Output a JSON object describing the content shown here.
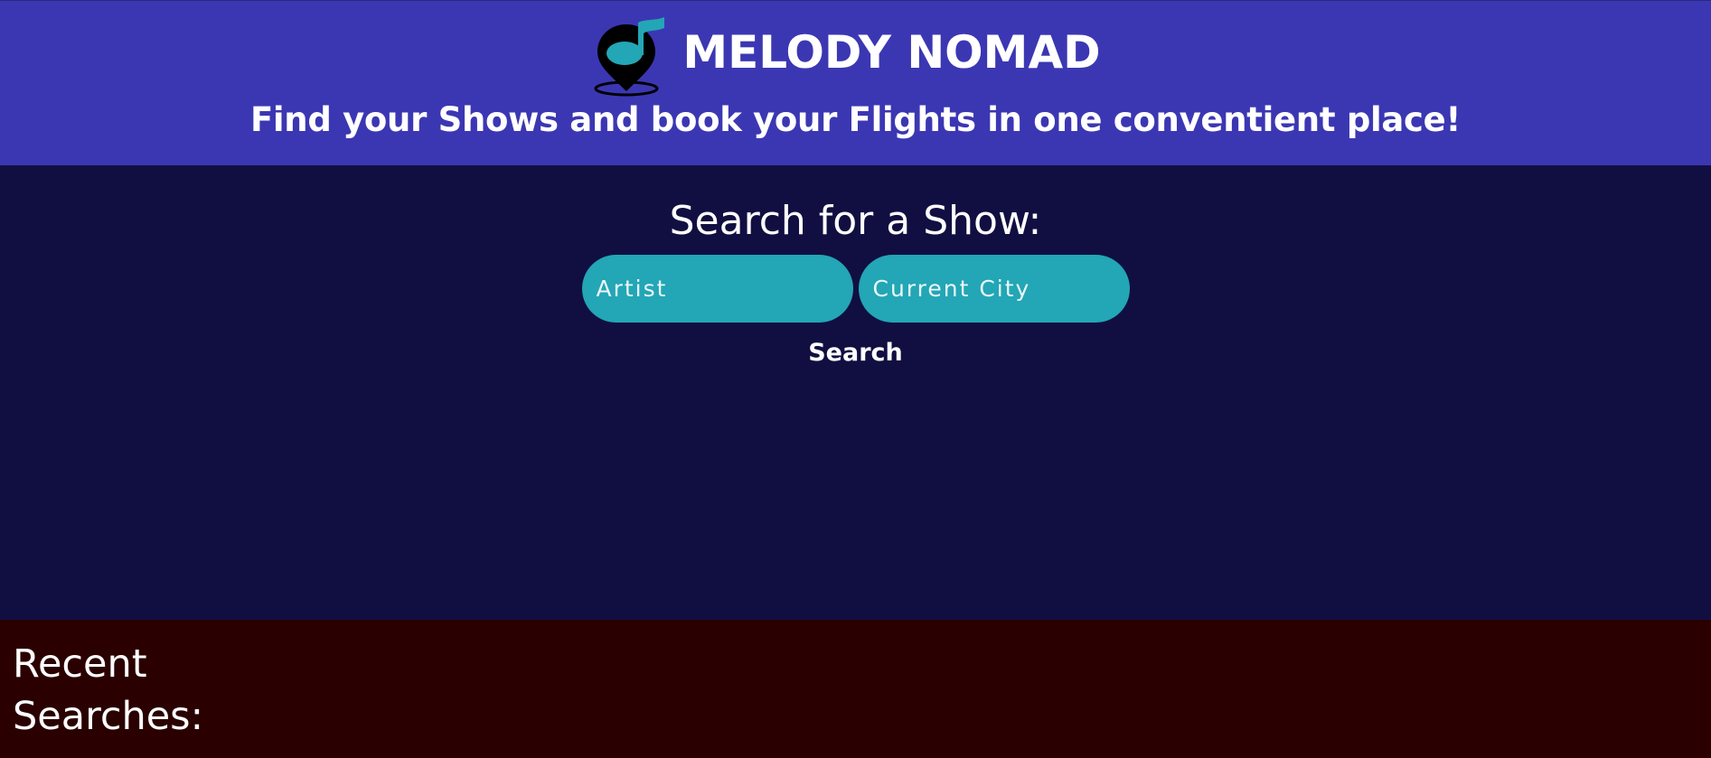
{
  "header": {
    "title": "MELODY NOMAD",
    "tagline": "Find your Shows and book your Flights in one conventient place!",
    "logo_icon": "music-note-map-pin-icon"
  },
  "search": {
    "heading": "Search for a Show:",
    "artist_placeholder": "Artist",
    "city_placeholder": "Current City",
    "button_label": "Search"
  },
  "recent": {
    "heading": "Recent Searches:"
  },
  "colors": {
    "header_bg": "#3b37b3",
    "main_bg": "#110f41",
    "input_bg": "#23a6b5",
    "recent_bg": "#2a0000"
  }
}
